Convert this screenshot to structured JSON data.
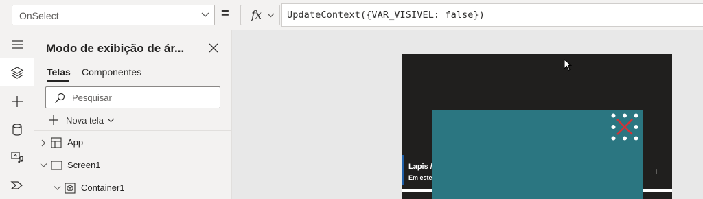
{
  "formula_bar": {
    "property": "OnSelect",
    "equals": "=",
    "fx": "fx",
    "formula": "UpdateContext({VAR_VISIVEL: false})"
  },
  "rail": {
    "items": [
      "menu-icon",
      "layers-icon",
      "plus-icon",
      "database-icon",
      "media-icon",
      "power-automate-icon"
    ]
  },
  "tree_panel": {
    "title": "Modo de exibição de ár...",
    "tabs": [
      {
        "label": "Telas",
        "active": true
      },
      {
        "label": "Componentes",
        "active": false
      }
    ],
    "search_placeholder": "Pesquisar",
    "new_screen_label": "Nova tela",
    "items": [
      {
        "label": "App",
        "icon": "app-icon",
        "expanded": false
      },
      {
        "label": "Screen1",
        "icon": "screen-icon",
        "expanded": true
      },
      {
        "label": "Container1",
        "icon": "container-icon",
        "expanded": true
      }
    ]
  },
  "canvas": {
    "card_title": "Lapis /",
    "card_subtitle": "Em este",
    "plus_symbol": "+"
  },
  "colors": {
    "accent_teal": "#2b7681",
    "app_background": "#201f1e",
    "close_x": "#d13438",
    "selection_accent": "#1e5fa8"
  }
}
